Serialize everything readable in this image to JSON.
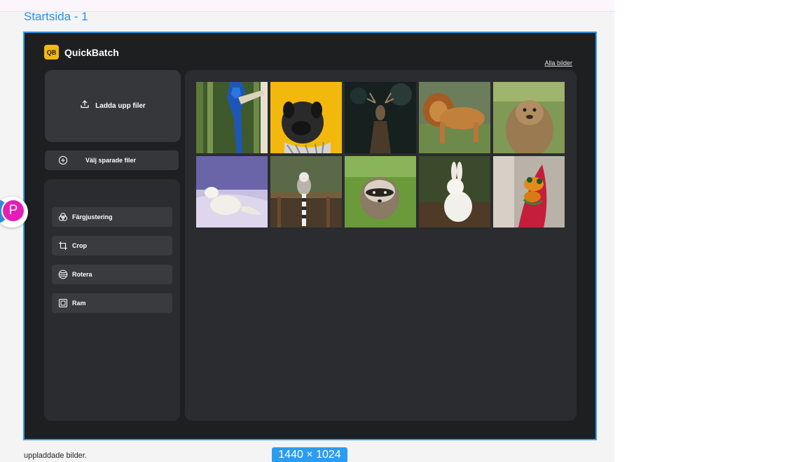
{
  "frame": {
    "title": "Startsida - 1",
    "dimensions": "1440 × 1024"
  },
  "app": {
    "logo_text": "QB",
    "name": "QuickBatch",
    "all_images_link": "Alla bilder"
  },
  "upload": {
    "label": "Ladda upp filer",
    "icon": "upload-icon"
  },
  "saved": {
    "label": "Välj sparade filer",
    "icon": "plus-circle-icon"
  },
  "tools": [
    {
      "label": "Färgjustering",
      "icon": "color-adjust-icon"
    },
    {
      "label": "Crop",
      "icon": "crop-icon"
    },
    {
      "label": "Rotera",
      "icon": "rotate-icon"
    },
    {
      "label": "Ram",
      "icon": "frame-icon"
    }
  ],
  "gallery": {
    "images": [
      {
        "subject": "blue parrot"
      },
      {
        "subject": "pug on yellow"
      },
      {
        "subject": "deer in forest"
      },
      {
        "subject": "lion walking"
      },
      {
        "subject": "marmot"
      },
      {
        "subject": "arctic fox in snow"
      },
      {
        "subject": "lemur on fence"
      },
      {
        "subject": "raccoon in grass"
      },
      {
        "subject": "white rabbit"
      },
      {
        "subject": "tree frog on red flower"
      }
    ]
  },
  "collaborator": {
    "initial": "P",
    "color": "#e41db8"
  },
  "footer": {
    "note": "uppladdade bilder."
  },
  "colors": {
    "accent": "#2c9cf0",
    "brand": "#f2b90c",
    "frame_bg": "#1e1f21",
    "panel_bg": "#2b2c2f"
  }
}
